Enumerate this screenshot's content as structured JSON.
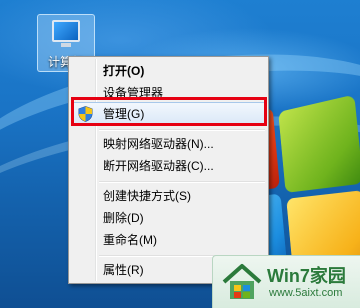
{
  "desktop": {
    "icon_label": "计算机",
    "icon_name": "computer-icon"
  },
  "context_menu": {
    "items": [
      {
        "label": "打开(O)",
        "bold": true
      },
      {
        "label": "设备管理器"
      },
      {
        "label": "管理(G)",
        "icon": "uac-shield-icon",
        "highlighted": true
      },
      {
        "label": "映射网络驱动器(N)..."
      },
      {
        "label": "断开网络驱动器(C)..."
      },
      {
        "label": "创建快捷方式(S)"
      },
      {
        "label": "删除(D)"
      },
      {
        "label": "重命名(M)"
      },
      {
        "label": "属性(R)"
      }
    ]
  },
  "watermark": {
    "title": "Win7家园",
    "url": "www.5aixt.com"
  },
  "colors": {
    "highlight_box": "#e60012",
    "menu_background": "#f0f0f0",
    "desktop_blue": "#1a74c6",
    "watermark_green": "#2b7a3b"
  }
}
